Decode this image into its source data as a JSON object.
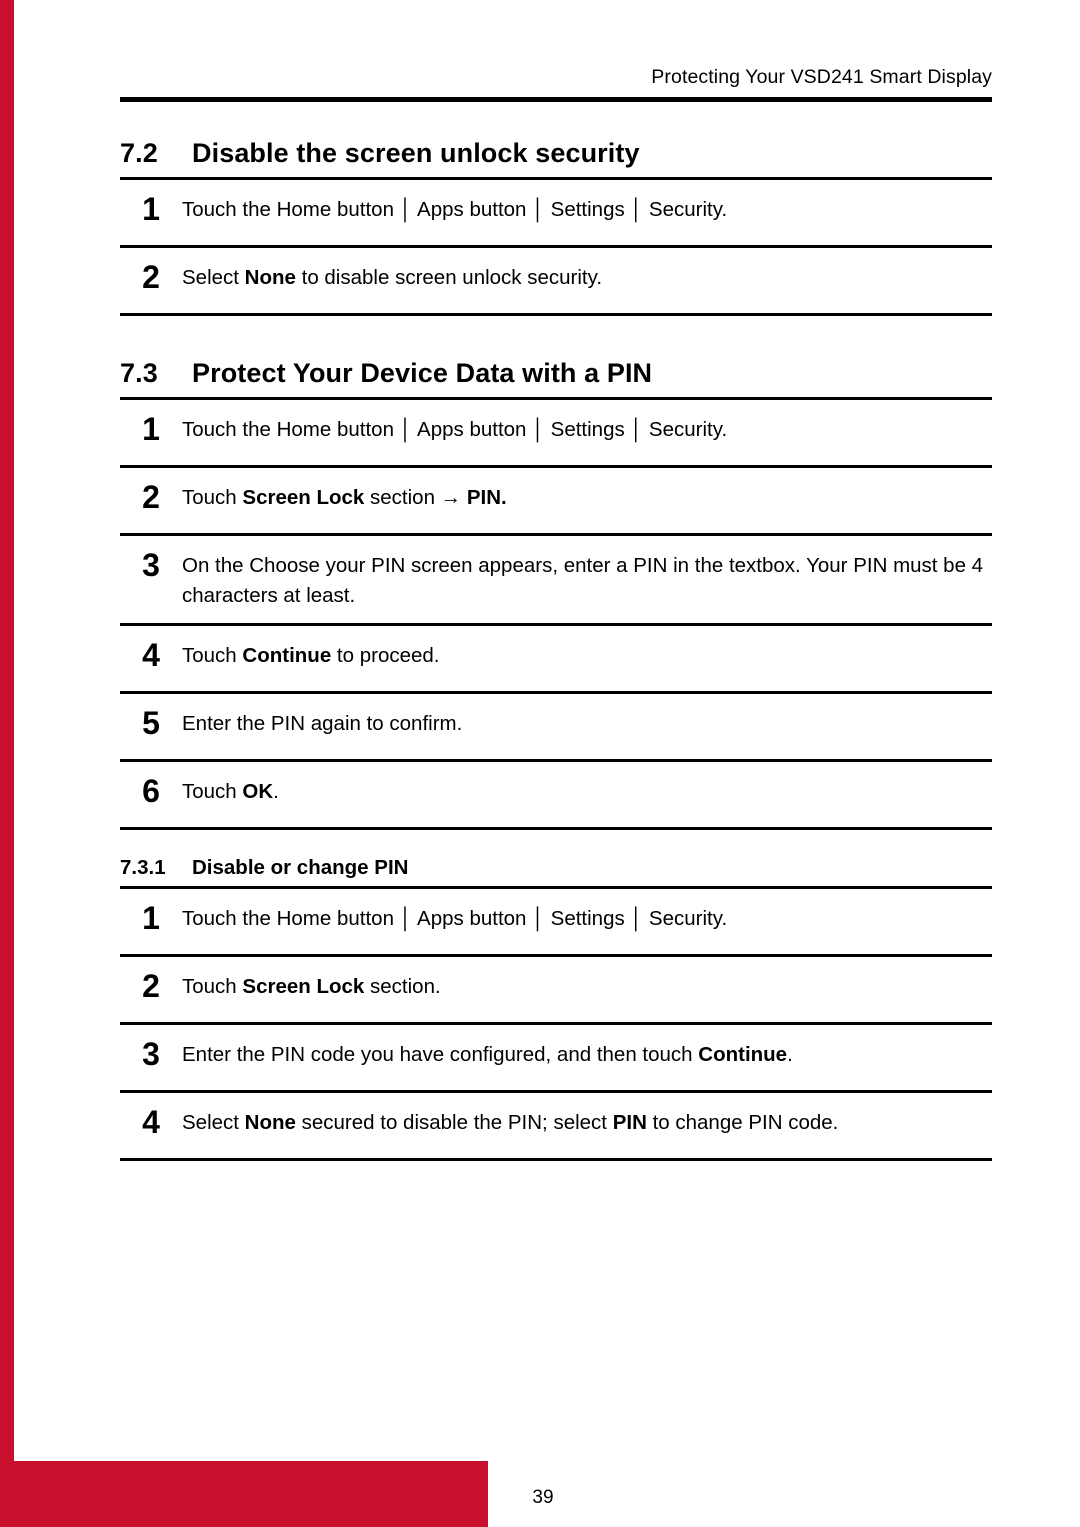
{
  "header": {
    "running_title": "Protecting Your VSD241 Smart Display"
  },
  "sections": [
    {
      "number": "7.2",
      "title": "Disable the screen unlock security",
      "steps": [
        {
          "num": "1",
          "text_html": "Touch the Home button │ Apps button │ Settings │ Security."
        },
        {
          "num": "2",
          "text_html": "Select <b>None</b> to disable screen unlock security."
        }
      ]
    },
    {
      "number": "7.3",
      "title": "Protect Your Device Data with a PIN",
      "steps": [
        {
          "num": "1",
          "text_html": "Touch the Home button │ Apps button │ Settings │ Security."
        },
        {
          "num": "2",
          "text_html": "Touch <b>Screen Lock</b> section → <b>PIN.</b>"
        },
        {
          "num": "3",
          "text_html": "On the Choose your PIN screen appears, enter a PIN in the textbox. Your PIN must be 4 characters at least."
        },
        {
          "num": "4",
          "text_html": "Touch <b>Continue</b> to proceed."
        },
        {
          "num": "5",
          "text_html": "Enter the PIN again to confirm."
        },
        {
          "num": "6",
          "text_html": "Touch <b>OK</b>."
        }
      ]
    }
  ],
  "subsection": {
    "number": "7.3.1",
    "title": "Disable or change PIN",
    "steps": [
      {
        "num": "1",
        "text_html": "Touch the Home button │ Apps button │ Settings │ Security."
      },
      {
        "num": "2",
        "text_html": "Touch <b>Screen Lock</b> section."
      },
      {
        "num": "3",
        "text_html": "Enter the PIN code you have configured, and then touch <b>Continue</b>."
      },
      {
        "num": "4",
        "text_html": "Select <b>None</b> secured to disable the PIN; select <b>PIN</b> to change PIN code."
      }
    ]
  },
  "footer": {
    "page_number": "39"
  },
  "colors": {
    "accent": "#c8102e",
    "text": "#000000",
    "background": "#ffffff"
  }
}
